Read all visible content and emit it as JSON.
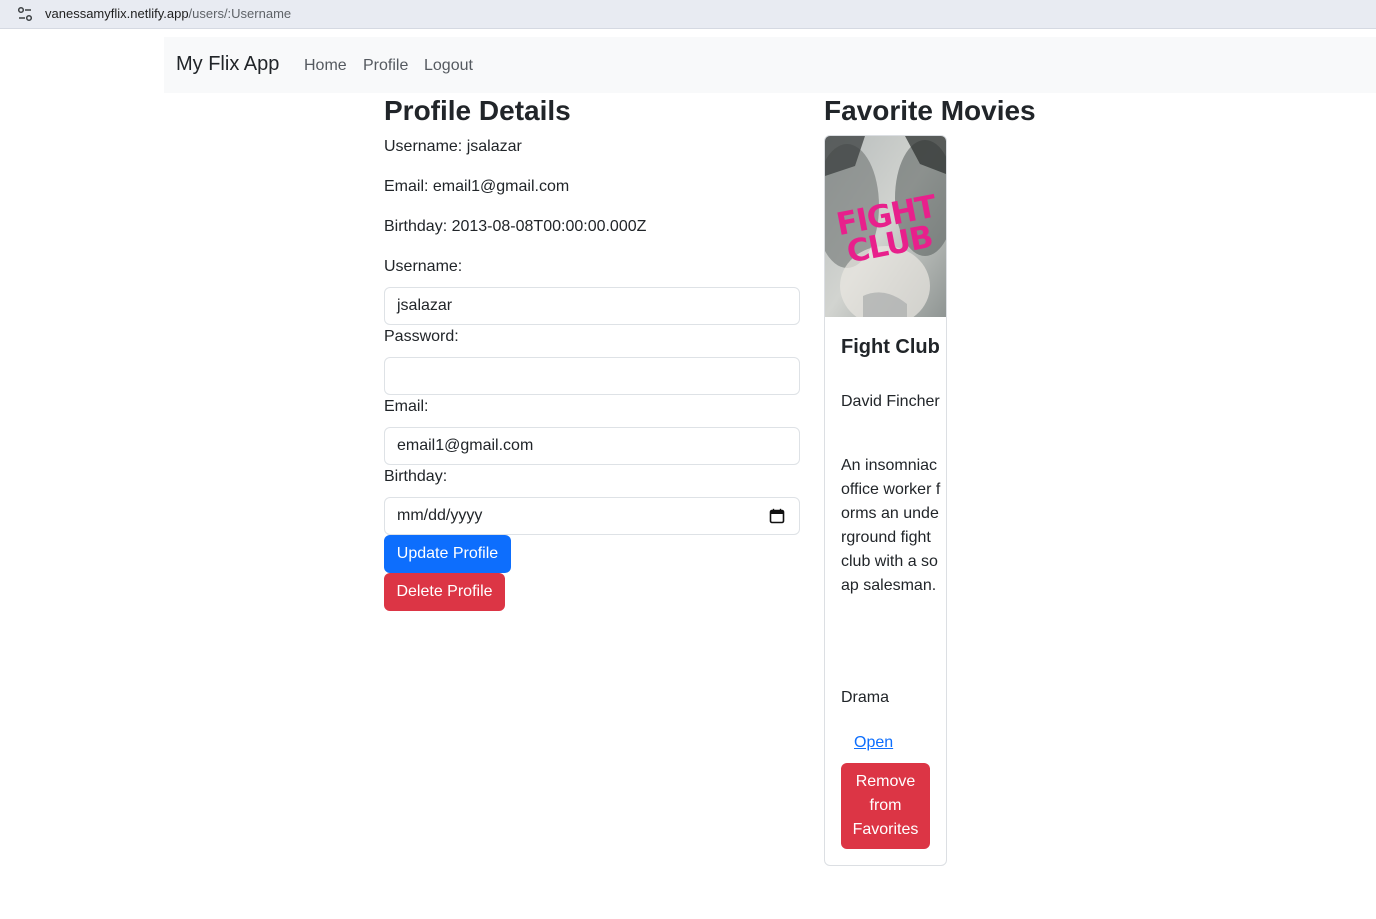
{
  "browser": {
    "url_host": "vanessamyflix.netlify.app",
    "url_path": "/users/:Username",
    "site_info_icon": "tune-icon"
  },
  "navbar": {
    "brand": "My Flix App",
    "links": [
      "Home",
      "Profile",
      "Logout"
    ]
  },
  "profile": {
    "heading": "Profile Details",
    "username_line": "Username: jsalazar",
    "email_line": "Email: email1@gmail.com",
    "birthday_line": "Birthday: 2013-08-08T00:00:00.000Z"
  },
  "form": {
    "username_label": "Username:",
    "username_value": "jsalazar",
    "password_label": "Password:",
    "password_value": "",
    "email_label": "Email:",
    "email_value": "email1@gmail.com",
    "birthday_label": "Birthday:",
    "birthday_placeholder": "mm/dd/yyyy",
    "update_button": "Update Profile",
    "delete_button": "Delete Profile"
  },
  "favorites": {
    "heading": "Favorite Movies",
    "movies": [
      {
        "title": "Fight Club",
        "poster_text": "FIGHT CLUB",
        "director": "David Fincher",
        "description": "An insomniac office worker forms an underground fight club with a soap salesman.",
        "genre": "Drama",
        "open_link": "Open",
        "remove_button": "Remove from Favorites"
      }
    ]
  },
  "colors": {
    "primary": "#0d6efd",
    "danger": "#dc3545",
    "navbar_bg": "#f8f9fa",
    "poster_pink": "#e8208c"
  }
}
